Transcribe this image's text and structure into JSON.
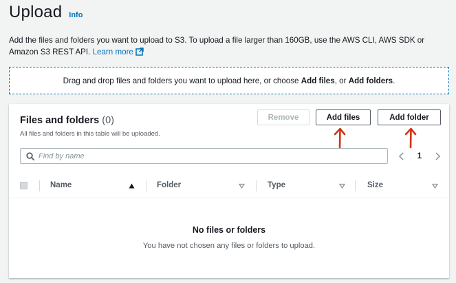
{
  "header": {
    "title": "Upload",
    "info_label": "Info"
  },
  "description": {
    "text": "Add the files and folders you want to upload to S3. To upload a file larger than 160GB, use the AWS CLI, AWS SDK or Amazon S3 REST API.",
    "learn_more": "Learn more"
  },
  "dropzone": {
    "prefix": "Drag and drop files and folders you want to upload here, or choose",
    "add_files": "Add files",
    "separator": ", or",
    "add_folders": "Add folders",
    "suffix": "."
  },
  "files_panel": {
    "title": "Files and folders",
    "count": "(0)",
    "subtitle": "All files and folders in this table will be uploaded.",
    "buttons": {
      "remove": "Remove",
      "add_files": "Add files",
      "add_folder": "Add folder"
    },
    "search": {
      "placeholder": "Find by name",
      "value": ""
    },
    "pagination": {
      "current_page": "1"
    },
    "columns": [
      "Name",
      "Folder",
      "Type",
      "Size"
    ],
    "empty": {
      "title": "No files or folders",
      "message": "You have not chosen any files or folders to upload."
    }
  },
  "colors": {
    "accent": "#0073bb",
    "annotation": "#d13212",
    "text": "#16191f",
    "muted": "#545b64",
    "background": "#f2f3f3"
  }
}
